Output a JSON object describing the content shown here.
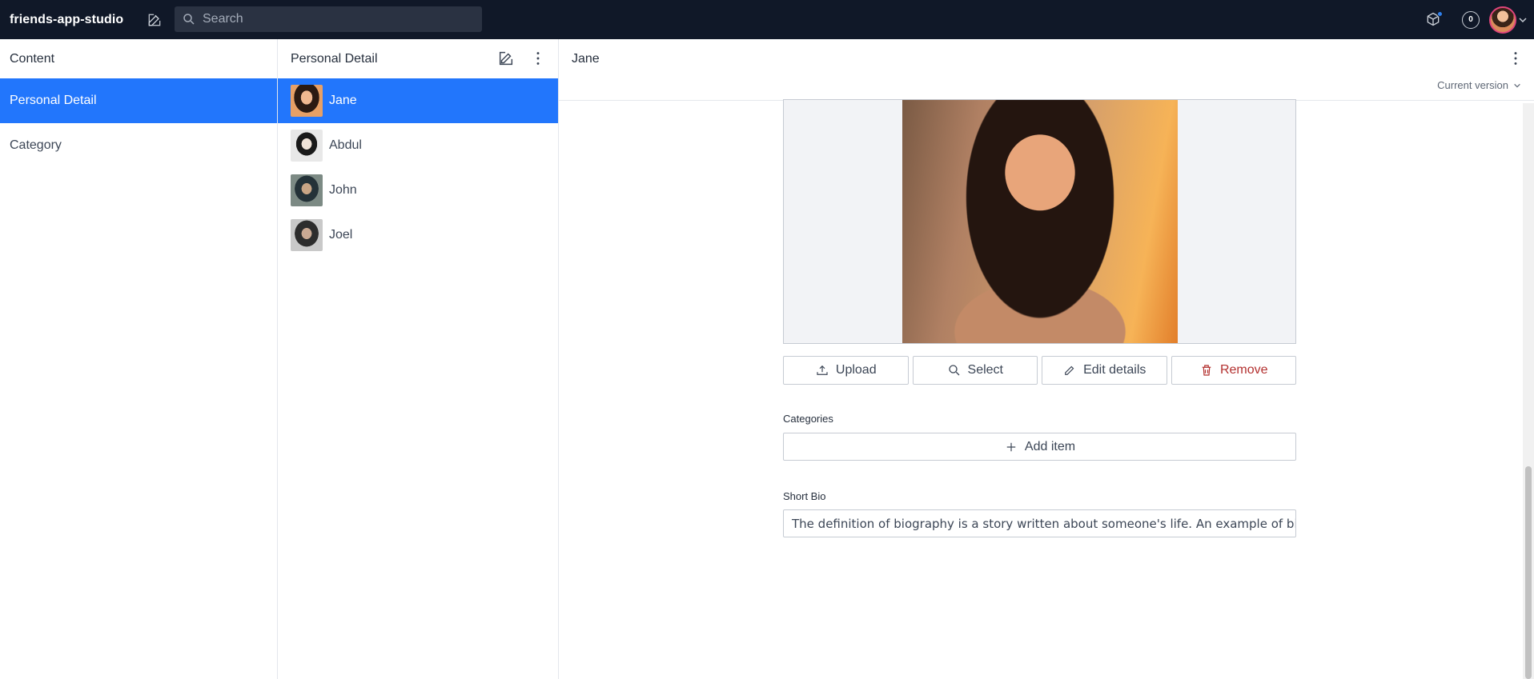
{
  "app": {
    "title": "friends-app-studio"
  },
  "search": {
    "placeholder": "Search"
  },
  "top": {
    "badge_count": "0"
  },
  "panes": {
    "content": {
      "header": "Content",
      "items": [
        {
          "label": "Personal Detail",
          "selected": true
        },
        {
          "label": "Category",
          "selected": false
        }
      ]
    },
    "list": {
      "header": "Personal Detail",
      "items": [
        {
          "label": "Jane",
          "selected": true
        },
        {
          "label": "Abdul",
          "selected": false
        },
        {
          "label": "John",
          "selected": false
        },
        {
          "label": "Joel",
          "selected": false
        }
      ]
    },
    "document": {
      "title": "Jane",
      "version": "Current version",
      "image_buttons": {
        "upload": "Upload",
        "select": "Select",
        "edit": "Edit details",
        "remove": "Remove"
      },
      "categories": {
        "label": "Categories",
        "add_item": "Add item"
      },
      "short_bio": {
        "label": "Short Bio",
        "value": "The definition of biography is a story written about someone's life. An example of biogr"
      }
    }
  },
  "colors": {
    "accent": "#2276fc",
    "navbar": "#101828",
    "danger": "#b3302f"
  }
}
